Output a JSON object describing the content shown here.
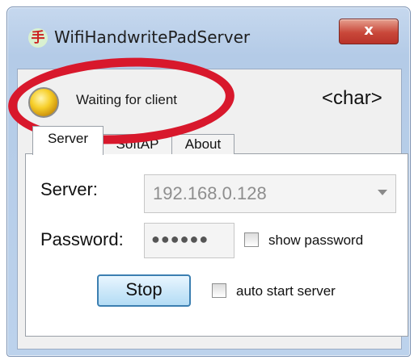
{
  "window": {
    "title": "WifiHandwritePadServer",
    "app_icon": "手",
    "close_glyph": "x"
  },
  "status": {
    "led": "status-led-icon",
    "led_color": "#f7cf2a",
    "text": "Waiting for client",
    "char_label": "<char>"
  },
  "tabs": [
    {
      "label": "Server",
      "active": true
    },
    {
      "label": "SoftAP",
      "active": false
    },
    {
      "label": "About",
      "active": false
    }
  ],
  "server_tab": {
    "server_label": "Server:",
    "server_value": "192.168.0.128",
    "password_label": "Password:",
    "password_value": "●●●●●●",
    "show_password_label": "show password",
    "show_password_checked": false,
    "stop_label": "Stop",
    "auto_start_label": "auto start server",
    "auto_start_checked": false
  },
  "annotation": {
    "color": "#d8182c"
  }
}
